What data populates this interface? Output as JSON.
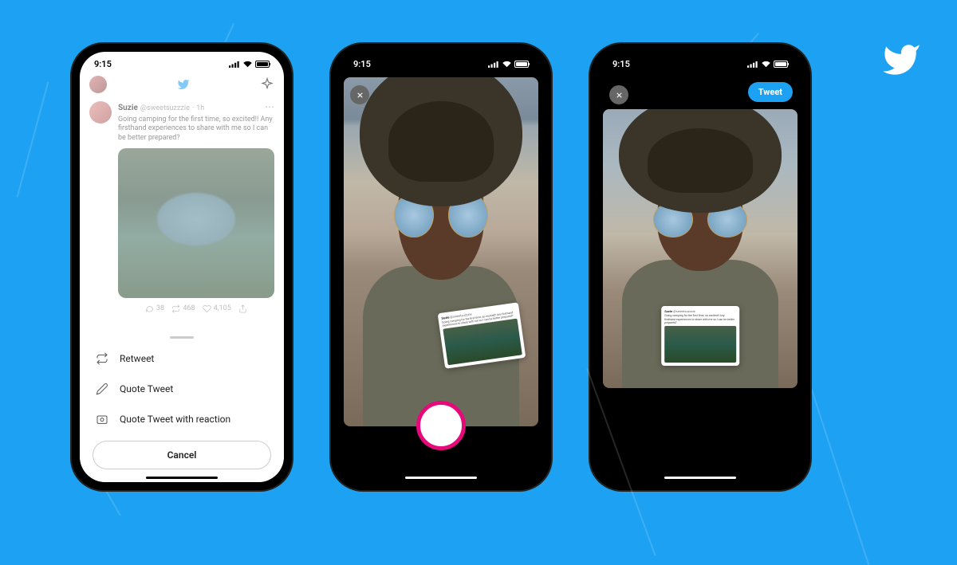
{
  "status": {
    "time": "9:15"
  },
  "tweet": {
    "name": "Suzie",
    "handle": "@sweetsuzzzie",
    "time": "1h",
    "text": "Going camping for the first time, so excited!! Any firsthand experiences to share with me so I can be better prepared?",
    "replies": "38",
    "retweets": "468",
    "likes": "4,105"
  },
  "sheet": {
    "retweet": "Retweet",
    "quote": "Quote Tweet",
    "reaction": "Quote Tweet with reaction",
    "cancel": "Cancel"
  },
  "compose": {
    "tweet_btn": "Tweet"
  }
}
